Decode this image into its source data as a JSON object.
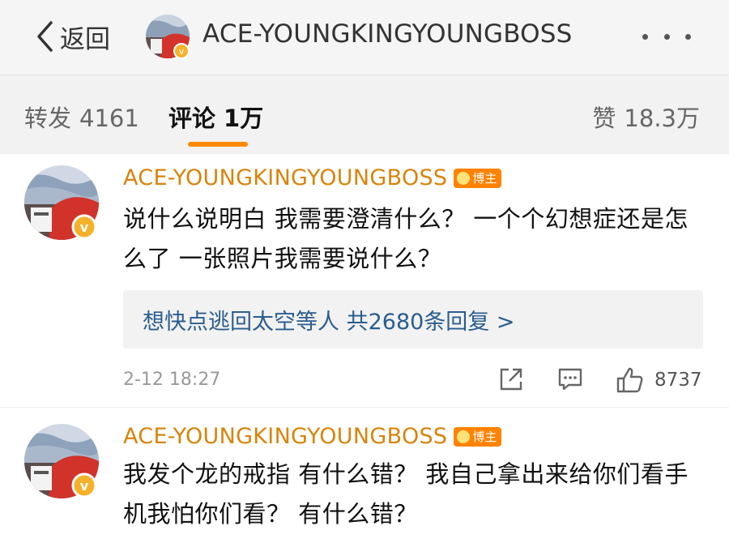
{
  "header": {
    "back_label": "返回",
    "title": "ACE-YOUNGKINGYOUNGBOSS",
    "more_icon": "ellipsis-icon"
  },
  "tabs": {
    "forward": {
      "label": "转发",
      "count": "4161"
    },
    "comment": {
      "label": "评论",
      "count": "1万",
      "active": true
    },
    "like": {
      "label": "赞",
      "count": "18.3万"
    }
  },
  "comments": [
    {
      "username": "ACE-YOUNGKINGYOUNGBOSS",
      "badge": "博主",
      "text": "说什么说明白 我需要澄清什么？ 一个个幻想症还是怎么了 一张照片我需要说什么？",
      "replies_text": "想快点逃回太空等人 共2680条回复 >",
      "timestamp": "2-12 18:27",
      "like_count": "8737"
    },
    {
      "username": "ACE-YOUNGKINGYOUNGBOSS",
      "badge": "博主",
      "text": "我发个龙的戒指 有什么错？ 我自己拿出来给你们看手机我怕你们看？ 有什么错？"
    }
  ],
  "colors": {
    "username": "#d8840c",
    "badge": "#ff8200",
    "active_tab_underline": "#ff8a00",
    "replies_link": "#2a5d8f"
  }
}
